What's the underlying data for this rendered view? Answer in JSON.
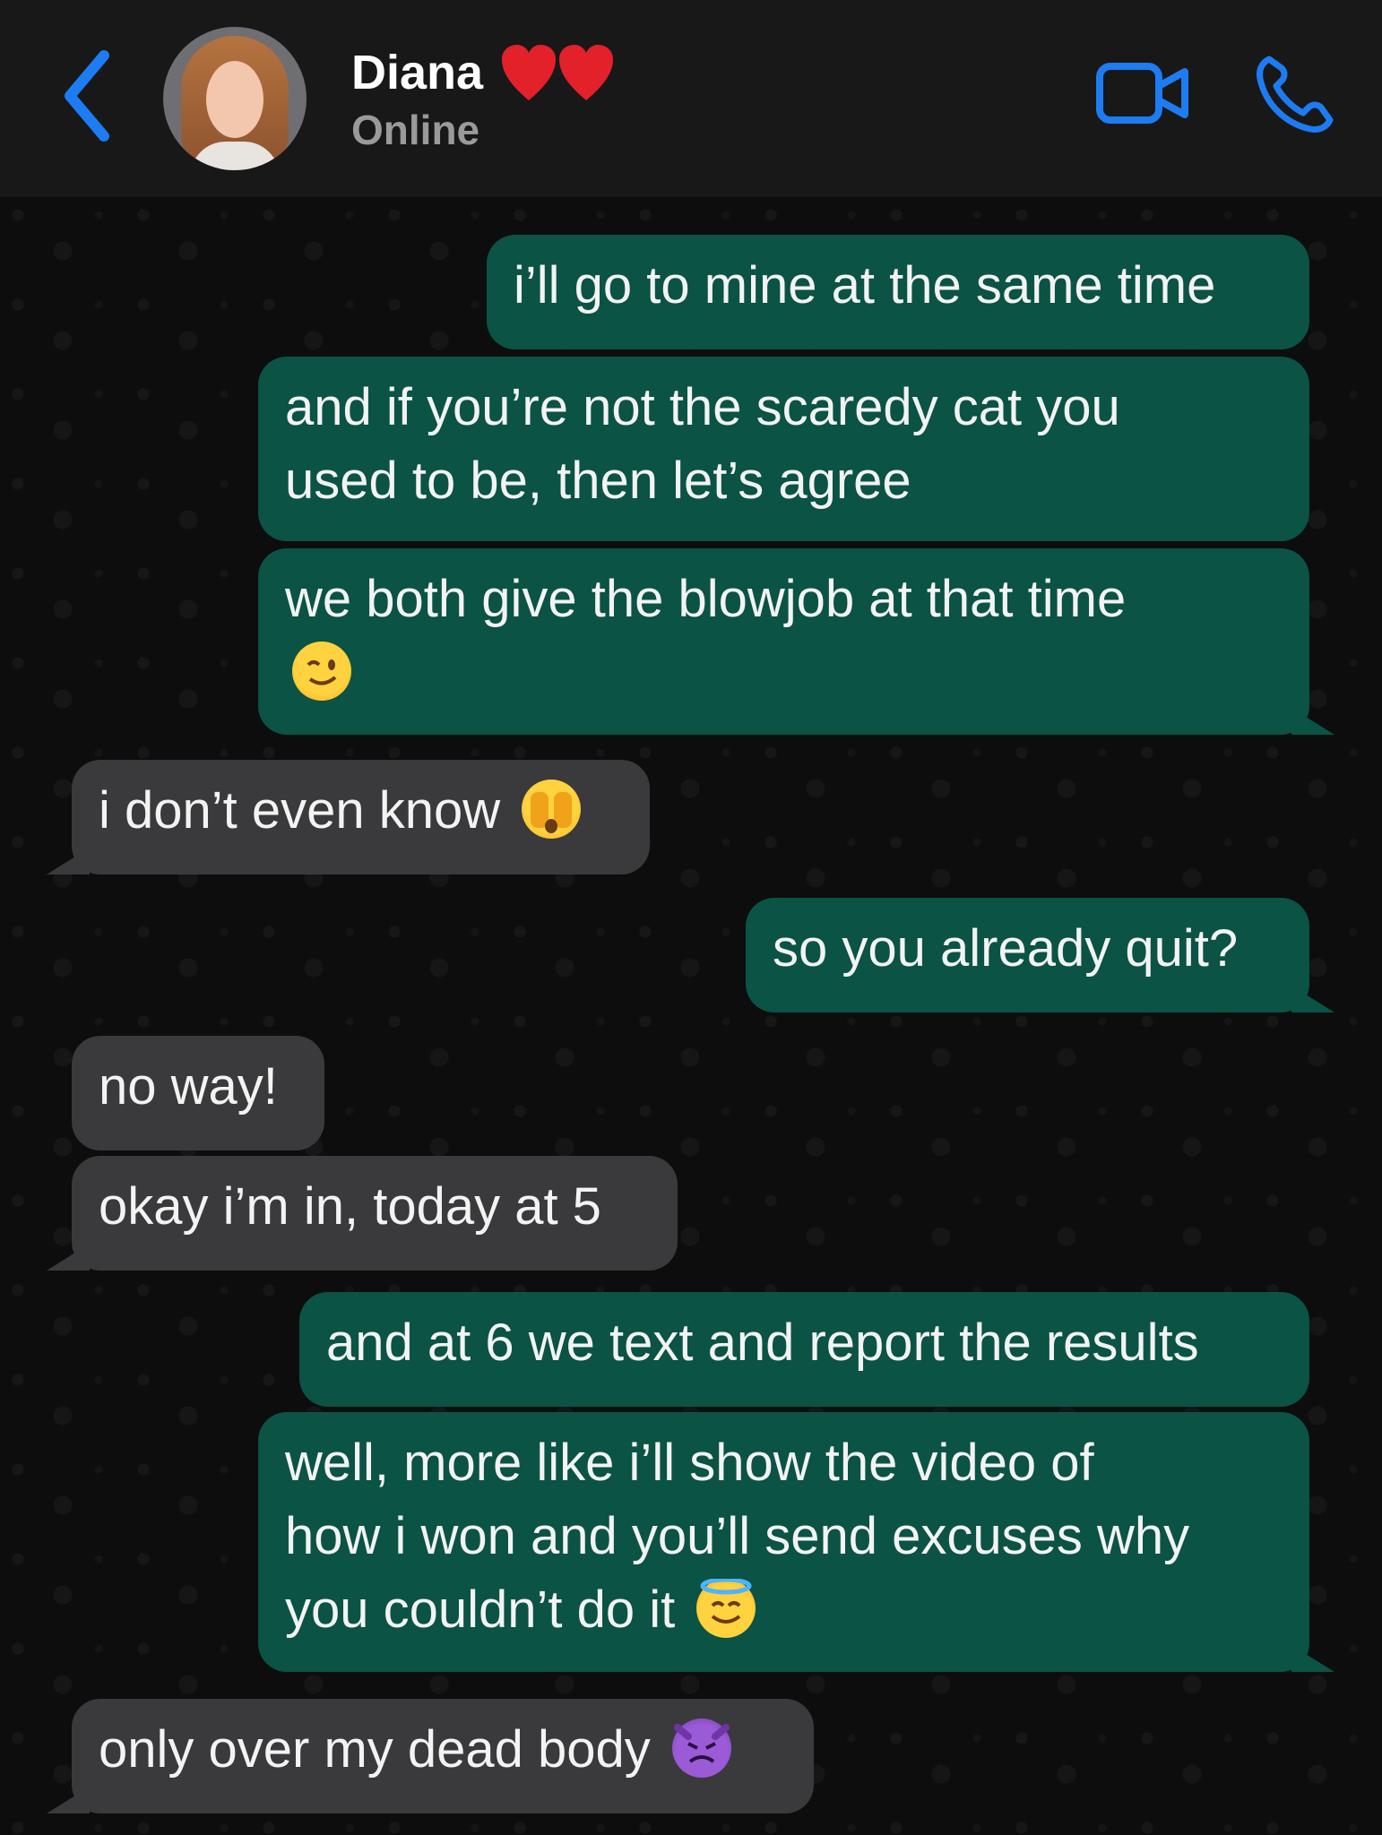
{
  "header": {
    "contact_name": "Diana",
    "status": "Online"
  },
  "colors": {
    "accent": "#1d7cf2",
    "outgoing_bubble": "#0b5344",
    "incoming_bubble": "#3a3a3c",
    "header_bg": "#181818",
    "status_text": "#9a9a9a"
  },
  "icons": [
    "back-chevron-icon",
    "avatar",
    "heart-icon",
    "heart-icon",
    "video-camera-icon",
    "phone-icon"
  ],
  "messages": [
    {
      "direction": "outgoing",
      "text": "i’ll go to mine at the same time"
    },
    {
      "direction": "outgoing",
      "line1": "and if you’re not the scaredy cat you",
      "line2": "used to be, then let’s agree"
    },
    {
      "direction": "outgoing",
      "text": "we both give the blowjob at that time",
      "emoji": "winking-face"
    },
    {
      "direction": "incoming",
      "text": "i don’t even know",
      "emoji": "face-with-peeking-eye"
    },
    {
      "direction": "outgoing",
      "text": "so you already quit?"
    },
    {
      "direction": "incoming",
      "text": "no way!"
    },
    {
      "direction": "incoming",
      "text": "okay i’m in, today at 5"
    },
    {
      "direction": "outgoing",
      "text": "and at 6 we text and report the results"
    },
    {
      "direction": "outgoing",
      "line1": "well, more like i’ll show the video of",
      "line2": "how i won and you’ll send excuses why",
      "line3": "you couldn’t do it",
      "emoji": "smiling-face-with-halo"
    },
    {
      "direction": "incoming",
      "text": "only over my dead body",
      "emoji": "angry-face-with-horns"
    }
  ]
}
